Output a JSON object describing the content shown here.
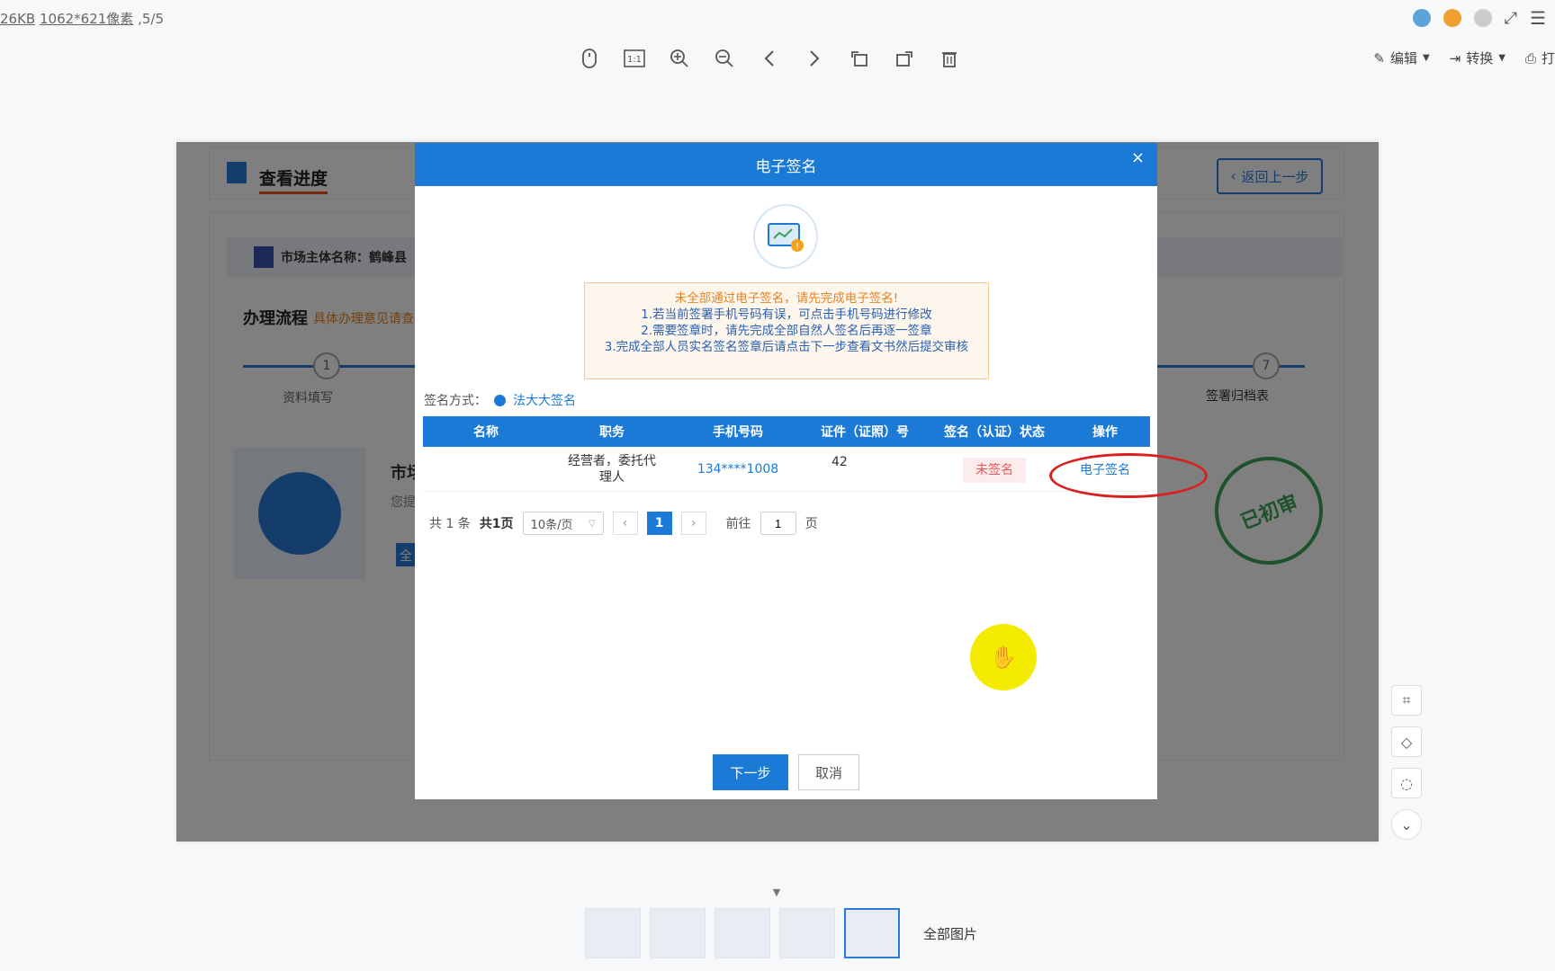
{
  "viewer": {
    "file_info_size": "26KB",
    "file_info_dims": "1062*621像素",
    "file_info_index": "5/5",
    "edit_label": "编辑",
    "convert_label": "转换",
    "print_label": "打",
    "all_images_label": "全部图片"
  },
  "toolbar_icons": [
    "mouse-icon",
    "actual-size-icon",
    "zoom-in-icon",
    "zoom-out-icon",
    "prev-icon",
    "next-icon",
    "rotate-left-icon",
    "rotate-right-icon",
    "delete-icon"
  ],
  "background_page": {
    "title": "查看进度",
    "back_button": "返回上一步",
    "market_label": "市场主体名称：鹤峰县",
    "flow_title": "办理流程",
    "flow_sub": "具体办理意见请查",
    "step1_num": "1",
    "step1_label": "资料填写",
    "step7_num": "7",
    "step7_label": "签署归档表",
    "card_title": "市场",
    "card_sub": "您提",
    "card_btn": "全",
    "stamp_text": "已初审"
  },
  "modal": {
    "title": "电子签名",
    "close": "×",
    "notice_warn": "未全部通过电子签名，请先完成电子签名!",
    "notice_1": "1.若当前签署手机号码有误，可点击手机号码进行修改",
    "notice_2": "2.需要签章时，请先完成全部自然人签名后再逐一签章",
    "notice_3": "3.完成全部人员实名签名签章后请点击下一步查看文书然后提交审核",
    "sign_mode_label": "签名方式：",
    "sign_mode_option": "法大大签名",
    "table": {
      "headers": [
        "名称",
        "职务",
        "手机号码",
        "证件（证照）号",
        "签名（认证）状态",
        "操作"
      ],
      "rows": [
        {
          "name": "",
          "position": "经营者，委托代理人",
          "phone": "134****1008",
          "id": "42",
          "status": "未签名",
          "action": "电子签名"
        }
      ]
    },
    "pager": {
      "total": "共 1 条",
      "pages": "共1页",
      "page_size": "10条/页",
      "current": "1",
      "goto_label": "前往",
      "goto_value": "1",
      "page_suffix": "页"
    },
    "next_button": "下一步",
    "cancel_button": "取消"
  },
  "colors": {
    "primary": "#1a7ad6",
    "warning": "#e8821e",
    "danger": "#e55555",
    "stamp_green": "#3aa55a",
    "highlight": "#f3ec00"
  }
}
